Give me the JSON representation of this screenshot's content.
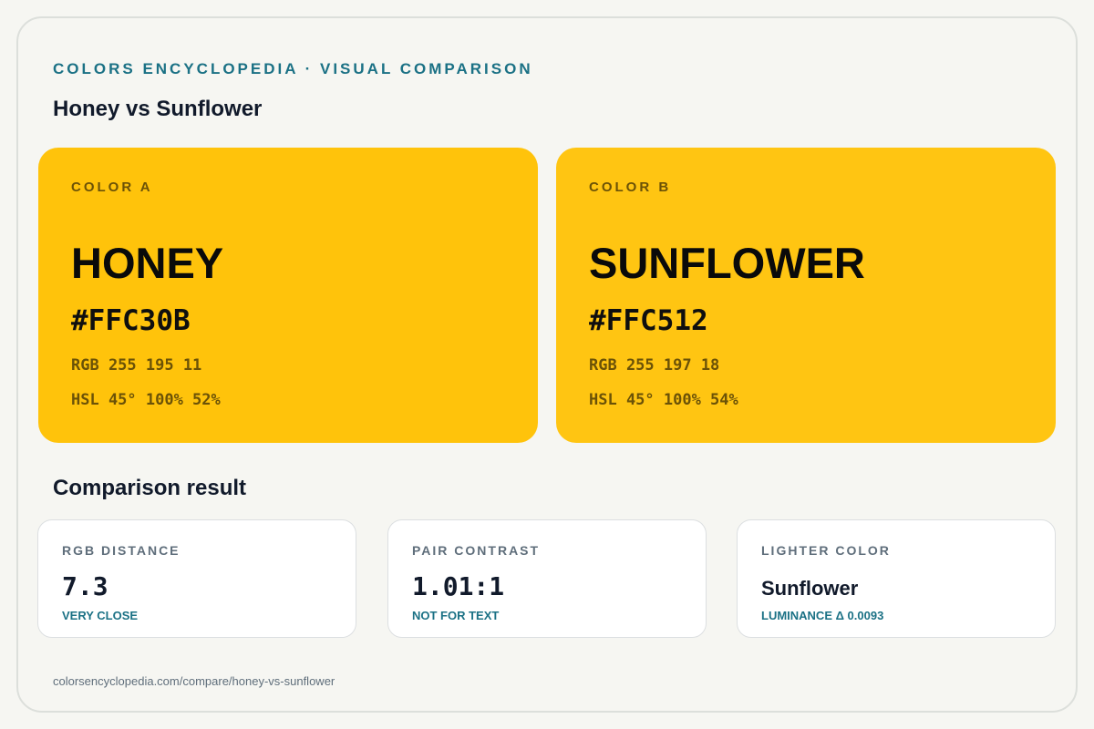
{
  "header": {
    "eyebrow": "COLORS ENCYCLOPEDIA · VISUAL COMPARISON",
    "title": "Honey vs Sunflower"
  },
  "colors": [
    {
      "tag": "COLOR A",
      "name": "HONEY",
      "hex": "#FFC30B",
      "rgb": "RGB 255 195 11",
      "hsl": "HSL 45° 100% 52%",
      "swatch_color": "#FFC30B"
    },
    {
      "tag": "COLOR B",
      "name": "SUNFLOWER",
      "hex": "#FFC512",
      "rgb": "RGB 255 197 18",
      "hsl": "HSL 45° 100% 54%",
      "swatch_color": "#FFC512"
    }
  ],
  "comparison": {
    "title": "Comparison result",
    "cards": [
      {
        "label": "RGB DISTANCE",
        "value": "7.3",
        "note": "VERY CLOSE"
      },
      {
        "label": "PAIR CONTRAST",
        "value": "1.01:1",
        "note": "NOT FOR TEXT"
      },
      {
        "label": "LIGHTER COLOR",
        "value": "Sunflower",
        "note": "LUMINANCE Δ 0.0093"
      }
    ]
  },
  "footer": {
    "url": "colorsencyclopedia.com/compare/honey-vs-sunflower"
  },
  "theme": {
    "accent": "#1B7185",
    "background": "#F6F6F2"
  }
}
